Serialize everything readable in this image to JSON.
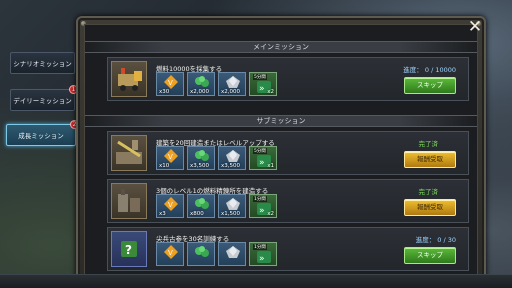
{
  "tabs": [
    {
      "label": "シナリオミッション",
      "badge": ""
    },
    {
      "label": "デイリーミッション",
      "badge": "1"
    },
    {
      "label": "成長ミッション",
      "badge": "2"
    }
  ],
  "sections": {
    "main": "メインミッション",
    "sub": "サブミッション"
  },
  "missions": [
    {
      "title": "燃料10000を採集する",
      "rewards": [
        {
          "icon": "vip-token-icon",
          "qty": "x30"
        },
        {
          "icon": "food-icon",
          "qty": "x2,000"
        },
        {
          "icon": "iron-icon",
          "qty": "x2,000"
        },
        {
          "icon": "speedup-icon",
          "qty": "x2",
          "top": "5分間"
        }
      ],
      "status": "進度： 0 / 10000",
      "button": "スキップ"
    },
    {
      "title": "建築を20回建造またはレベルアップする",
      "rewards": [
        {
          "icon": "vip-token-icon",
          "qty": "x10"
        },
        {
          "icon": "food-icon",
          "qty": "x3,500"
        },
        {
          "icon": "iron-icon",
          "qty": "x3,500"
        },
        {
          "icon": "speedup-icon",
          "qty": "x1",
          "top": "5分間"
        }
      ],
      "status": "完了済",
      "button": "報酬受取"
    },
    {
      "title": "3個のレベル1の燃料精錬所を建造する",
      "rewards": [
        {
          "icon": "vip-token-icon",
          "qty": "x3"
        },
        {
          "icon": "food-icon",
          "qty": "x800"
        },
        {
          "icon": "iron-icon",
          "qty": "x1,500"
        },
        {
          "icon": "speedup-icon",
          "qty": "x2",
          "top": "1分間"
        }
      ],
      "status": "完了済",
      "button": "報酬受取"
    },
    {
      "title": "尖兵古参を30名訓練する",
      "rewards": [
        {
          "icon": "vip-token-icon",
          "qty": ""
        },
        {
          "icon": "food-icon",
          "qty": ""
        },
        {
          "icon": "iron-icon",
          "qty": ""
        },
        {
          "icon": "speedup-icon",
          "qty": "",
          "top": "1分間"
        }
      ],
      "status": "進度： 0 / 30",
      "button": "スキップ"
    }
  ],
  "colors": {
    "progress_text": "#9fd4ff",
    "completed_text": "#7ee05a",
    "skip_button": "#3e9a28",
    "claim_button": "#e0a820"
  }
}
